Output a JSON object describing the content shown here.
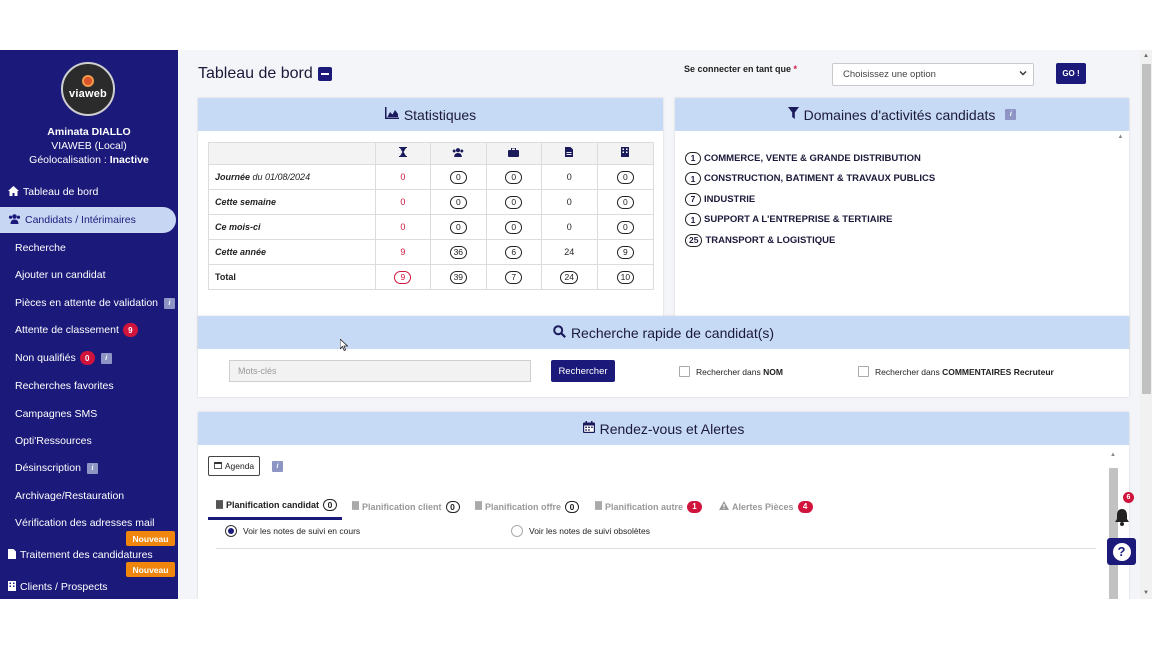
{
  "user": {
    "logo_text": "viaweb",
    "name": "Aminata DIALLO",
    "org": "VIAWEB (Local)",
    "geo_label": "Géolocalisation : ",
    "geo_status": "Inactive"
  },
  "nav": {
    "dashboard": "Tableau de bord",
    "candidates": "Candidats / Intérimaires",
    "search": "Recherche",
    "add_candidate": "Ajouter un candidat",
    "pending_docs": "Pièces en attente de validation",
    "waiting_rank": "Attente de classement",
    "waiting_rank_count": "9",
    "unqualified": "Non qualifiés",
    "unqualified_count": "0",
    "favorites": "Recherches favorites",
    "sms": "Campagnes SMS",
    "opti": "Opti'Ressources",
    "unsubscribe": "Désinscription",
    "archive": "Archivage/Restauration",
    "mail_verify": "Vérification des adresses mail",
    "applications": "Traitement des candidatures",
    "clients": "Clients / Prospects",
    "new_badge": "Nouveau",
    "info_glyph": "i"
  },
  "header": {
    "title": "Tableau de bord",
    "login_label": "Se connecter en tant que",
    "required": "*",
    "login_select": "Choisissez une option",
    "go": "GO !"
  },
  "stats": {
    "title": "Statistiques",
    "rows": [
      {
        "label": "Journée",
        "date": " du 01/08/2024",
        "v": [
          "0",
          "0",
          "0",
          "0",
          "0"
        ]
      },
      {
        "label": "Cette semaine",
        "date": "",
        "v": [
          "0",
          "0",
          "0",
          "0",
          "0"
        ]
      },
      {
        "label": "Ce mois-ci",
        "date": "",
        "v": [
          "0",
          "0",
          "0",
          "0",
          "0"
        ]
      },
      {
        "label": "Cette année",
        "date": "",
        "v": [
          "9",
          "36",
          "6",
          "24",
          "9"
        ]
      },
      {
        "label": "Total",
        "date": "",
        "v": [
          "9",
          "39",
          "7",
          "24",
          "10"
        ]
      }
    ]
  },
  "domains": {
    "title": "Domaines d'activités candidats",
    "items": [
      {
        "count": "1",
        "label": "COMMERCE, VENTE & GRANDE DISTRIBUTION"
      },
      {
        "count": "1",
        "label": "CONSTRUCTION, BATIMENT & TRAVAUX PUBLICS"
      },
      {
        "count": "7",
        "label": "INDUSTRIE"
      },
      {
        "count": "1",
        "label": "SUPPORT A L'ENTREPRISE & TERTIAIRE"
      },
      {
        "count": "25",
        "label": "TRANSPORT & LOGISTIQUE"
      }
    ]
  },
  "quick_search": {
    "title": "Recherche rapide de candidat(s)",
    "placeholder": "Mots-clés",
    "button": "Rechercher",
    "chk_name_prefix": "Rechercher dans ",
    "chk_name_bold": "NOM",
    "chk_comments_prefix": "Rechercher dans ",
    "chk_comments_bold": "COMMENTAIRES Recruteur"
  },
  "rdv": {
    "title": "Rendez-vous et Alertes",
    "agenda": "Agenda",
    "tabs": [
      {
        "label": "Planification candidat",
        "count": "0"
      },
      {
        "label": "Planification client",
        "count": "0"
      },
      {
        "label": "Planification offre",
        "count": "0"
      },
      {
        "label": "Planification autre",
        "count": "1"
      },
      {
        "label": "Alertes Pièces",
        "count": "4"
      }
    ],
    "radio_current": "Voir les notes de suivi en cours",
    "radio_obsolete": "Voir les notes de suivi obsolètes"
  },
  "notifications": {
    "count": "6"
  }
}
